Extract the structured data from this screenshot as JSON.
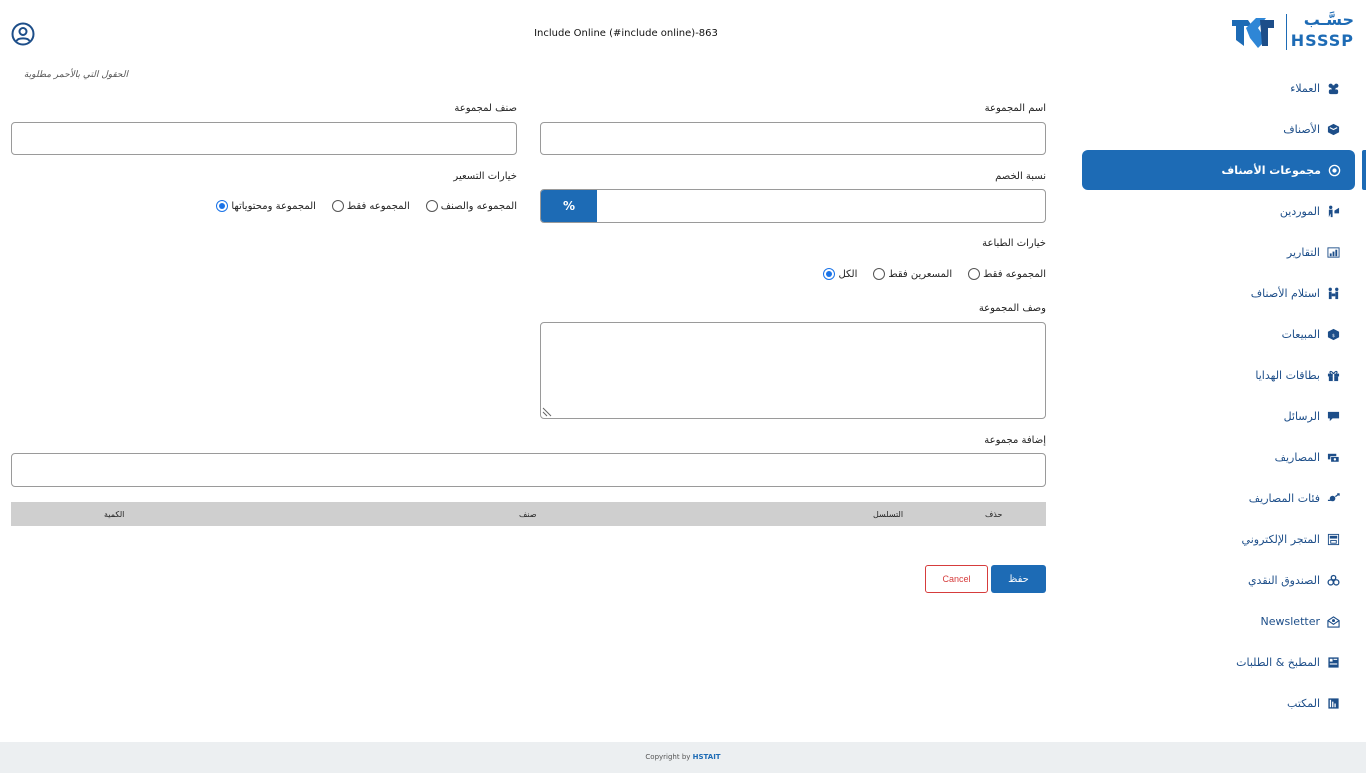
{
  "header": {
    "title": "Include Online (#include online)-863"
  },
  "logo": {
    "arabic": "حسَّـب",
    "latin": "HSSSP"
  },
  "form": {
    "required_note": "الحقول التي بالأحمر مطلوبة",
    "group_name_label": "اسم المجموعة",
    "group_category_label": "صنف لمجموعة",
    "discount_label": "نسبة الخصم",
    "discount_symbol": "%",
    "pricing_label": "خيارات التسعير",
    "pricing_options": [
      {
        "label": "المجموعة ومحتوياتها",
        "checked": true
      },
      {
        "label": "المجموعه فقط",
        "checked": false
      },
      {
        "label": "المجموعه والصنف",
        "checked": false
      }
    ],
    "print_label": "خيارات الطباعة",
    "print_options": [
      {
        "label": "الكل",
        "checked": true
      },
      {
        "label": "المسعرين فقط",
        "checked": false
      },
      {
        "label": "المجموعه فقط",
        "checked": false
      }
    ],
    "description_label": "وصف المجموعة",
    "add_group_label": "إضافة مجموعة"
  },
  "table": {
    "columns": [
      "حذف",
      "التسلسل",
      "صنف",
      "الكمية"
    ]
  },
  "actions": {
    "save": "حفظ",
    "cancel": "Cancel"
  },
  "sidebar": {
    "items": [
      {
        "label": "العملاء",
        "icon": "users-icon",
        "active": false
      },
      {
        "label": "الأصناف",
        "icon": "box-icon",
        "active": false
      },
      {
        "label": "مجموعات الأصناف",
        "icon": "target-icon",
        "active": true
      },
      {
        "label": "الموردين",
        "icon": "supplier-icon",
        "active": false
      },
      {
        "label": "التقارير",
        "icon": "report-icon",
        "active": false
      },
      {
        "label": "استلام الأصناف",
        "icon": "receive-icon",
        "active": false
      },
      {
        "label": "المبيعات",
        "icon": "sales-icon",
        "active": false
      },
      {
        "label": "بطاقات الهدايا",
        "icon": "gift-icon",
        "active": false
      },
      {
        "label": "الرسائل",
        "icon": "message-icon",
        "active": false
      },
      {
        "label": "المصاريف",
        "icon": "expense-icon",
        "active": false
      },
      {
        "label": "فئات المصاريف",
        "icon": "expense-category-icon",
        "active": false
      },
      {
        "label": "المتجر الإلكتروني",
        "icon": "store-icon",
        "active": false
      },
      {
        "label": "الصندوق النقدي",
        "icon": "cashbox-icon",
        "active": false
      },
      {
        "label": "Newsletter",
        "icon": "newsletter-icon",
        "active": false
      },
      {
        "label": "المطبخ & الطلبات",
        "icon": "kitchen-icon",
        "active": false
      },
      {
        "label": "المكتب",
        "icon": "office-icon",
        "active": false
      }
    ]
  },
  "footer": {
    "text": "Copyright by",
    "brand": "HSTAIT"
  },
  "colors": {
    "primary": "#1d6bb5",
    "danger": "#d63c3c",
    "footer_bg": "#eceff1"
  }
}
